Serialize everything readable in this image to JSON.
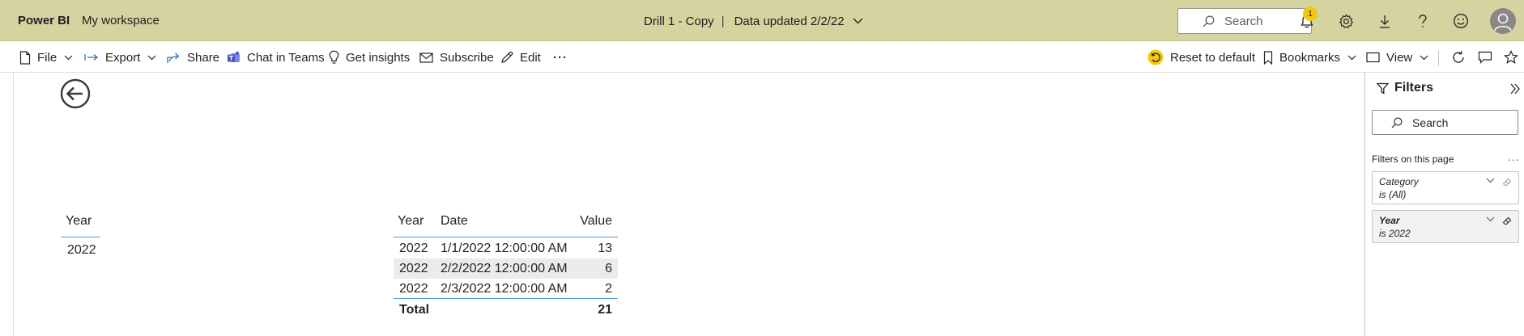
{
  "header": {
    "brand": "Power BI",
    "workspace": "My workspace",
    "report_title": "Drill 1 - Copy",
    "separator": "|",
    "data_updated": "Data updated 2/2/22",
    "search_placeholder": "Search",
    "notification_count": "1",
    "bg_color": "#d5d3a0",
    "icons": [
      "bell-icon",
      "gear-icon",
      "download-icon",
      "help-icon",
      "feedback-smiley-icon",
      "avatar-icon"
    ]
  },
  "commandbar": {
    "file": "File",
    "export": "Export",
    "share": "Share",
    "chat_in_teams": "Chat in Teams",
    "get_insights": "Get insights",
    "subscribe": "Subscribe",
    "edit": "Edit",
    "more": "···",
    "reset_to_default": "Reset to default",
    "bookmarks": "Bookmarks",
    "view": "View"
  },
  "canvas": {
    "slicer": {
      "header": "Year",
      "value": "2022"
    },
    "table": {
      "accent_color": "#4a9bd6",
      "headers": {
        "year": "Year",
        "date": "Date",
        "value": "Value"
      },
      "rows": [
        {
          "year": "2022",
          "date": "1/1/2022 12:00:00 AM",
          "value": "13"
        },
        {
          "year": "2022",
          "date": "2/2/2022 12:00:00 AM",
          "value": "6"
        },
        {
          "year": "2022",
          "date": "2/3/2022 12:00:00 AM",
          "value": "2"
        }
      ],
      "total": {
        "label": "Total",
        "value": "21"
      }
    }
  },
  "filters": {
    "title": "Filters",
    "search_placeholder": "Search",
    "section_label": "Filters on this page",
    "more": "...",
    "cards": [
      {
        "name": "Category",
        "desc": "is (All)",
        "applied": false
      },
      {
        "name": "Year",
        "desc": "is 2022",
        "applied": true
      }
    ]
  }
}
